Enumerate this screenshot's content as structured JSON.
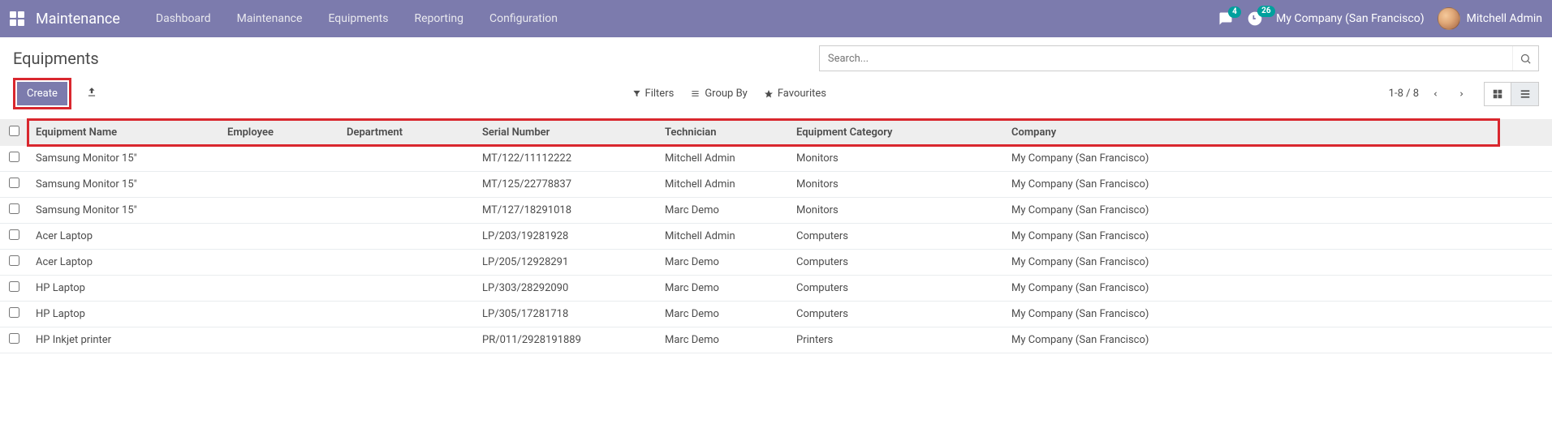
{
  "brand": "Maintenance",
  "menu": [
    "Dashboard",
    "Maintenance",
    "Equipments",
    "Reporting",
    "Configuration"
  ],
  "systray": {
    "conv_badge": "4",
    "activity_badge": "26"
  },
  "company": "My Company (San Francisco)",
  "user": "Mitchell Admin",
  "breadcrumb": "Equipments",
  "search_placeholder": "Search...",
  "buttons": {
    "create": "Create",
    "filters": "Filters",
    "groupby": "Group By",
    "favourites": "Favourites"
  },
  "pager": "1-8 / 8",
  "cols": [
    "Equipment Name",
    "Employee",
    "Department",
    "Serial Number",
    "Technician",
    "Equipment Category",
    "Company"
  ],
  "rows": [
    {
      "name": "Samsung Monitor 15\"",
      "employee": "",
      "department": "",
      "serial": "MT/122/11112222",
      "technician": "Mitchell Admin",
      "category": "Monitors",
      "company": "My Company (San Francisco)"
    },
    {
      "name": "Samsung Monitor 15\"",
      "employee": "",
      "department": "",
      "serial": "MT/125/22778837",
      "technician": "Mitchell Admin",
      "category": "Monitors",
      "company": "My Company (San Francisco)"
    },
    {
      "name": "Samsung Monitor 15\"",
      "employee": "",
      "department": "",
      "serial": "MT/127/18291018",
      "technician": "Marc Demo",
      "category": "Monitors",
      "company": "My Company (San Francisco)"
    },
    {
      "name": "Acer Laptop",
      "employee": "",
      "department": "",
      "serial": "LP/203/19281928",
      "technician": "Mitchell Admin",
      "category": "Computers",
      "company": "My Company (San Francisco)"
    },
    {
      "name": "Acer Laptop",
      "employee": "",
      "department": "",
      "serial": "LP/205/12928291",
      "technician": "Marc Demo",
      "category": "Computers",
      "company": "My Company (San Francisco)"
    },
    {
      "name": "HP Laptop",
      "employee": "",
      "department": "",
      "serial": "LP/303/28292090",
      "technician": "Marc Demo",
      "category": "Computers",
      "company": "My Company (San Francisco)"
    },
    {
      "name": "HP Laptop",
      "employee": "",
      "department": "",
      "serial": "LP/305/17281718",
      "technician": "Marc Demo",
      "category": "Computers",
      "company": "My Company (San Francisco)"
    },
    {
      "name": "HP Inkjet printer",
      "employee": "",
      "department": "",
      "serial": "PR/011/2928191889",
      "technician": "Marc Demo",
      "category": "Printers",
      "company": "My Company (San Francisco)"
    }
  ]
}
